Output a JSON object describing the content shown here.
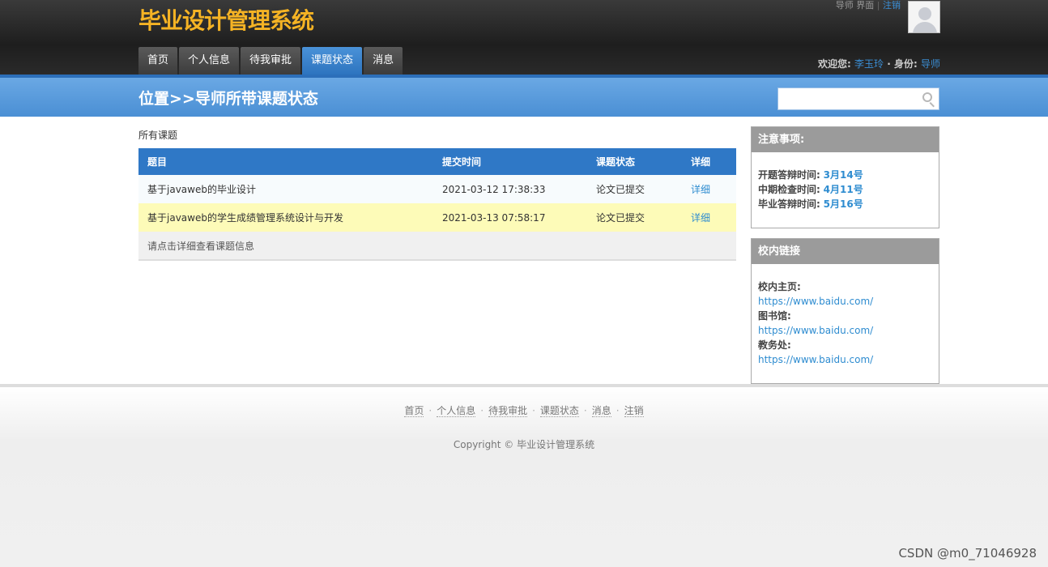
{
  "header": {
    "site_title": "毕业设计管理系统",
    "role_link": "导师 界面",
    "separator": "|",
    "logout_link": "注销",
    "welcome_label": "欢迎您:",
    "user_name": "李玉玲",
    "identity_label": "· 身份:",
    "identity_value": "导师"
  },
  "nav": {
    "tabs": [
      {
        "label": "首页"
      },
      {
        "label": "个人信息"
      },
      {
        "label": "待我审批"
      },
      {
        "label": "课题状态"
      },
      {
        "label": "消息"
      }
    ],
    "active": "课题状态"
  },
  "locbar": {
    "title": "位置>>导师所带课题状态",
    "search_placeholder": ""
  },
  "main": {
    "section_label": "所有课题",
    "columns": [
      "题目",
      "提交时间",
      "课题状态",
      "详细"
    ],
    "rows": [
      {
        "title": "基于javaweb的毕业设计",
        "time": "2021-03-12 17:38:33",
        "status": "论文已提交",
        "detail": "详细"
      },
      {
        "title": "基于javaweb的学生成绩管理系统设计与开发",
        "time": "2021-03-13 07:58:17",
        "status": "论文已提交",
        "detail": "详细"
      }
    ],
    "hint": "请点击详细查看课题信息"
  },
  "notice": {
    "title": "注意事项:",
    "items": [
      {
        "label": "开题答辩时间:",
        "value": "3月14号"
      },
      {
        "label": "中期检查时间:",
        "value": "4月11号"
      },
      {
        "label": "毕业答辩时间:",
        "value": "5月16号"
      }
    ]
  },
  "links": {
    "title": "校内链接",
    "items": [
      {
        "label": "校内主页:",
        "url": "https://www.baidu.com/"
      },
      {
        "label": "图书馆:",
        "url": "https://www.baidu.com/"
      },
      {
        "label": "教务处:",
        "url": "https://www.baidu.com/"
      }
    ]
  },
  "footer": {
    "links": [
      "首页",
      "个人信息",
      "待我审批",
      "课题状态",
      "消息",
      "注销"
    ],
    "dot": "·",
    "copyright": "Copyright © 毕业设计管理系统"
  },
  "watermark": "CSDN @m0_71046928",
  "colors": {
    "brand_yellow": "#f5b324",
    "accent_blue": "#2f78c6",
    "highlight_row": "#fdfbb8"
  }
}
